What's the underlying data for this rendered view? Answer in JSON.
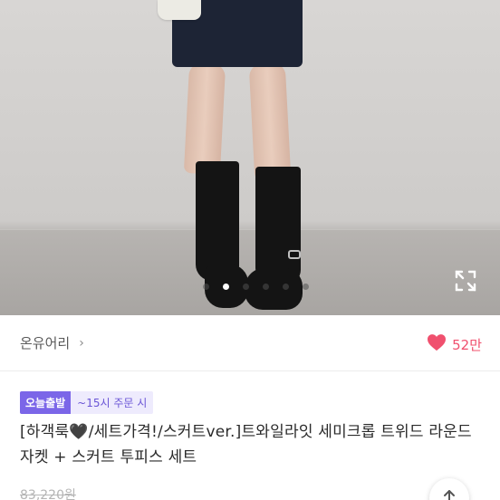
{
  "product": {
    "image_count": 6,
    "active_image_index": 2
  },
  "seller": {
    "name": "온유어리",
    "chevron": "›"
  },
  "like": {
    "count": "52만",
    "icon": "heart-icon",
    "color": "#f0506e"
  },
  "badges": {
    "today_label": "오늘출발",
    "time_label": "~15시 주문 시",
    "accent_color": "#7b66e8"
  },
  "title": "[하객룩🖤/세트가격!/스커트ver.]트와일라잇 세미크롭 트위드 라운드 자켓 + 스커트 투피스 세트",
  "price": {
    "original": "83,220원"
  },
  "icons": {
    "expand": "expand-icon",
    "scroll_top": "arrow-up-icon"
  }
}
